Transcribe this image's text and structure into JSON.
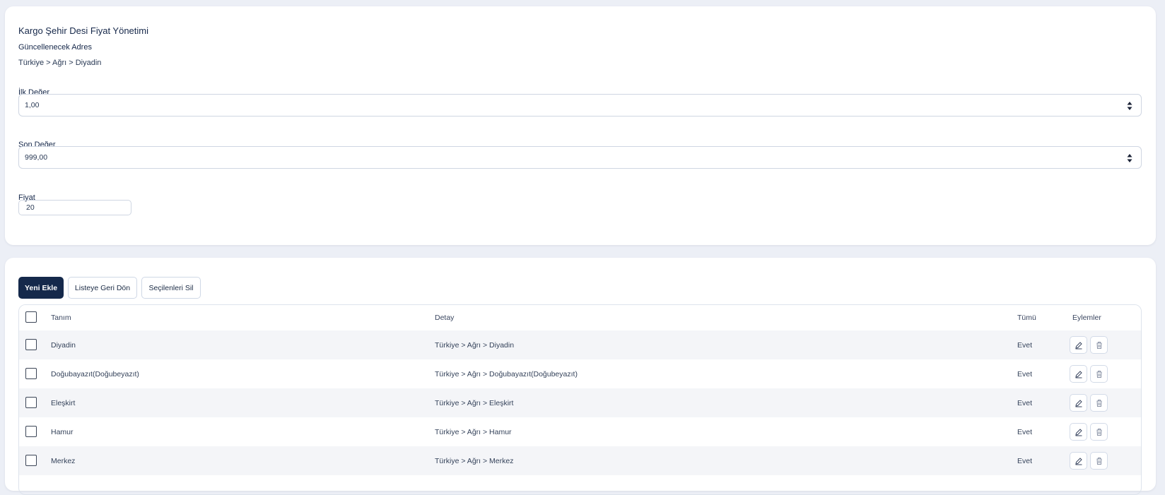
{
  "form": {
    "title": "Kargo Şehir Desi Fiyat Yönetimi",
    "address_label": "Güncellenecek Adres",
    "address_value": "Türkiye > Ağrı > Diyadin",
    "first_value_label": "İlk Değer",
    "first_value": "1,00",
    "last_value_label": "Son Değer",
    "last_value": "999,00",
    "price_label": "Fiyat",
    "price_value": "20"
  },
  "toolbar": {
    "add_new": "Yeni Ekle",
    "back_to_list": "Listeye Geri Dön",
    "delete_selected": "Seçilenleri Sil"
  },
  "table": {
    "headers": {
      "name": "Tanım",
      "detail": "Detay",
      "all": "Tümü",
      "actions": "Eylemler"
    },
    "rows": [
      {
        "name": "Diyadin",
        "detail": "Türkiye > Ağrı > Diyadin",
        "all": "Evet"
      },
      {
        "name": "Doğubayazıt(Doğubeyazıt)",
        "detail": "Türkiye > Ağrı > Doğubayazıt(Doğubeyazıt)",
        "all": "Evet"
      },
      {
        "name": "Eleşkirt",
        "detail": "Türkiye > Ağrı > Eleşkirt",
        "all": "Evet"
      },
      {
        "name": "Hamur",
        "detail": "Türkiye > Ağrı > Hamur",
        "all": "Evet"
      },
      {
        "name": "Merkez",
        "detail": "Türkiye > Ağrı > Merkez",
        "all": "Evet"
      }
    ]
  },
  "icons": {
    "edit": "pencil-icon",
    "delete": "trash-icon",
    "spinner": "spinner-arrows-icon"
  },
  "colors": {
    "primary": "#15294b",
    "background": "#eceff6",
    "row_alt": "#f4f5f8"
  }
}
